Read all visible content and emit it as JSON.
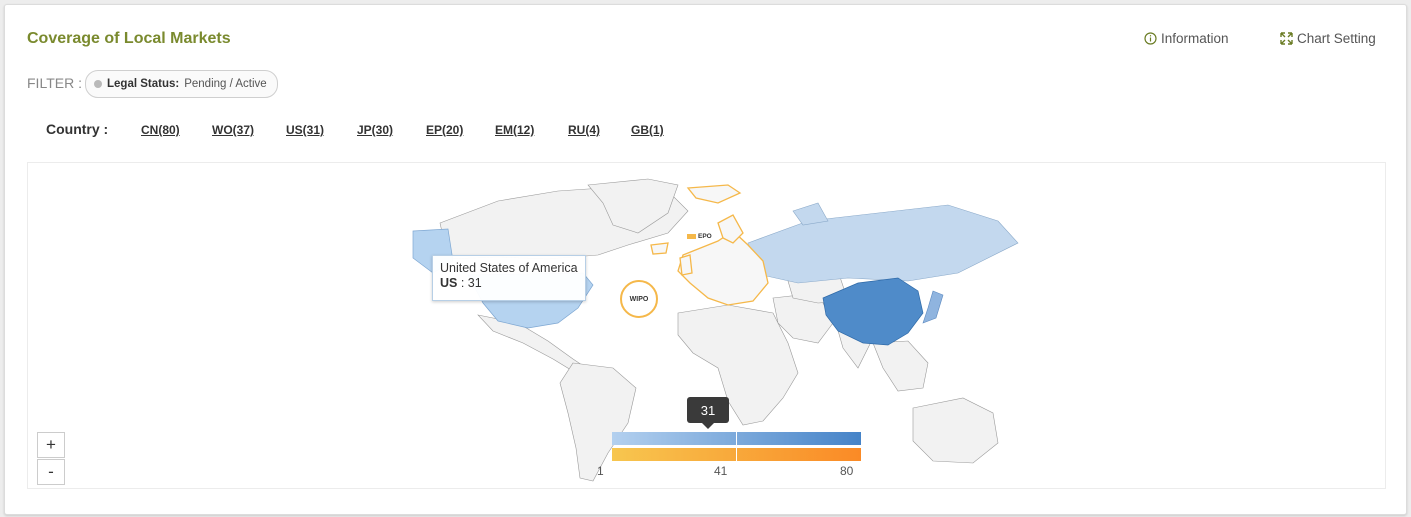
{
  "header": {
    "title": "Coverage of Local Markets",
    "info_label": "Information",
    "setting_label": "Chart Setting"
  },
  "filter": {
    "label": "FILTER :",
    "pill_key": "Legal Status:",
    "pill_value": "Pending / Active"
  },
  "country": {
    "label": "Country :",
    "items": [
      {
        "label": "CN(80)"
      },
      {
        "label": "WO(37)"
      },
      {
        "label": "US(31)"
      },
      {
        "label": "JP(30)"
      },
      {
        "label": "EP(20)"
      },
      {
        "label": "EM(12)"
      },
      {
        "label": "RU(4)"
      },
      {
        "label": "GB(1)"
      }
    ]
  },
  "map": {
    "tooltip": {
      "name": "United States of America",
      "code": "US",
      "value": ": 31"
    },
    "wipo_label": "WIPO",
    "epo_label": "EPO",
    "zoom_in": "+",
    "zoom_out": "-",
    "legend": {
      "marker": "31",
      "min": "1",
      "mid": "41",
      "max": "80"
    },
    "colors": {
      "light_blue": "#b3d0ef",
      "dark_blue": "#4583c8",
      "light_orange": "#f7c64f",
      "dark_orange": "#fa8a26",
      "land": "#f2f2f2",
      "europe_border": "#f5b84a"
    }
  }
}
